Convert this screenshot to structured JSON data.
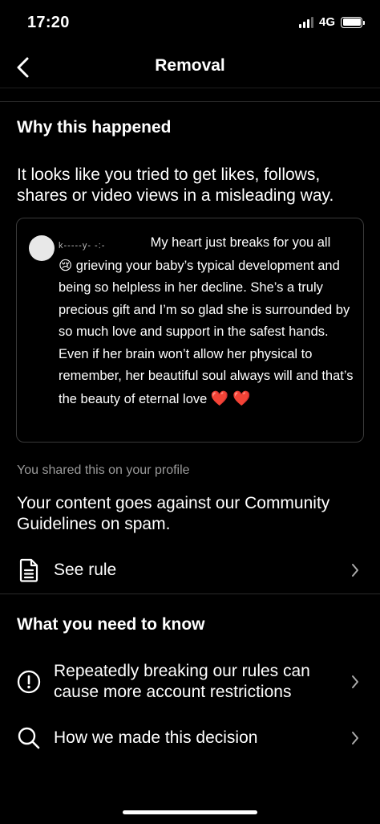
{
  "status_bar": {
    "time": "17:20",
    "network": "4G"
  },
  "header": {
    "title": "Removal",
    "back_icon": "chevron-left-icon"
  },
  "why_section": {
    "title": "Why this happened",
    "description": "It looks like you tried to get likes, follows, shares or video views in a misleading way."
  },
  "quoted_comment": {
    "username": "k-----y- -:-",
    "text_part1": " My heart just breaks for you all ",
    "emoji_cry": "😢",
    "text_part2": " grieving your baby’s typical development and being so helpless in her decline. She’s a truly precious gift and I’m so glad she is surrounded by so much love and support in the safest hands. Even if her brain won’t allow her physical to remember, her beautiful soul always will and that’s the beauty of eternal love ",
    "hearts": "❤️ ❤️"
  },
  "shared_caption": "You shared this on your profile",
  "violation_text": "Your content goes against our Community Guidelines on spam.",
  "see_rule": {
    "label": "See rule",
    "icon": "document-icon"
  },
  "know_section": {
    "title": "What you need to know",
    "items": [
      {
        "label": "Repeatedly breaking our rules can cause more account restrictions",
        "icon": "exclamation-circle-icon"
      },
      {
        "label": "How we made this decision",
        "icon": "search-icon"
      }
    ]
  },
  "colors": {
    "background": "#000000",
    "text": "#ffffff",
    "muted": "#9a9a9a",
    "border": "#3a3a3a",
    "heart": "#e0342f"
  }
}
